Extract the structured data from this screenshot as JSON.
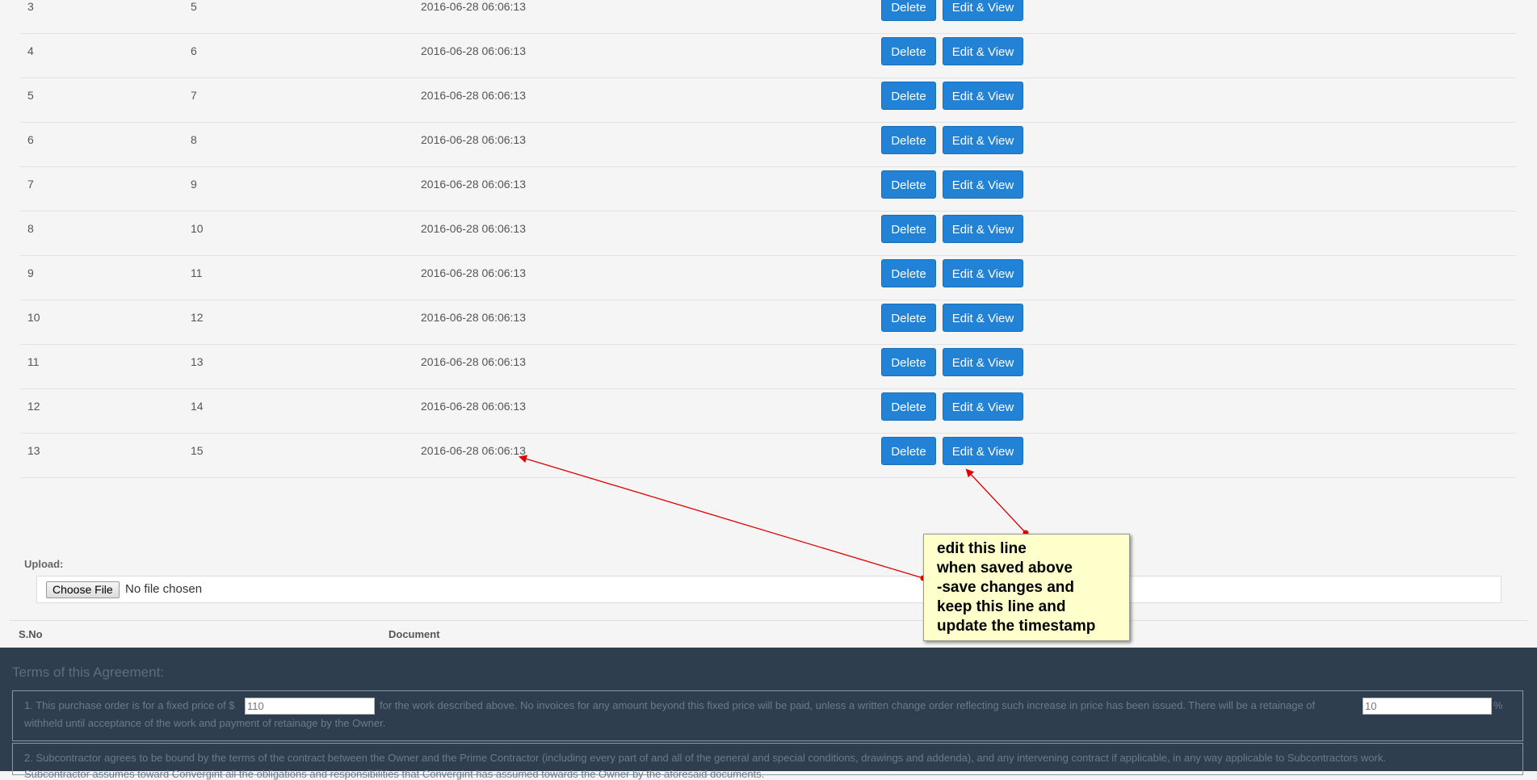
{
  "table": {
    "rows": [
      {
        "sno": "3",
        "id": "5",
        "timestamp": "2016-06-28 06:06:13"
      },
      {
        "sno": "4",
        "id": "6",
        "timestamp": "2016-06-28 06:06:13"
      },
      {
        "sno": "5",
        "id": "7",
        "timestamp": "2016-06-28 06:06:13"
      },
      {
        "sno": "6",
        "id": "8",
        "timestamp": "2016-06-28 06:06:13"
      },
      {
        "sno": "7",
        "id": "9",
        "timestamp": "2016-06-28 06:06:13"
      },
      {
        "sno": "8",
        "id": "10",
        "timestamp": "2016-06-28 06:06:13"
      },
      {
        "sno": "9",
        "id": "11",
        "timestamp": "2016-06-28 06:06:13"
      },
      {
        "sno": "10",
        "id": "12",
        "timestamp": "2016-06-28 06:06:13"
      },
      {
        "sno": "11",
        "id": "13",
        "timestamp": "2016-06-28 06:06:13"
      },
      {
        "sno": "12",
        "id": "14",
        "timestamp": "2016-06-28 06:06:13"
      },
      {
        "sno": "13",
        "id": "15",
        "timestamp": "2016-06-28 06:06:13"
      }
    ],
    "delete_label": "Delete",
    "edit_label": "Edit & View"
  },
  "upload": {
    "label": "Upload:",
    "choose_label": "Choose File",
    "status": "No file chosen"
  },
  "documents": {
    "headers": [
      "S.No",
      "Document"
    ]
  },
  "terms": {
    "title": "Terms of this Agreement:",
    "clause1_a": "1. This purchase order is for a fixed price of $",
    "price_value": "110",
    "clause1_b": "for the work described above. No invoices for any amount beyond this fixed price will be paid, unless a written change order reflecting such increase in price has been issued. There will be a retainage of",
    "retainage_value": "10",
    "clause1_c": "%",
    "clause1_line2": "withheld until acceptance of the work and payment of retainage by the Owner.",
    "clause2_line1": "2. Subcontractor agrees to be bound by the terms of the contract between the Owner and the Prime Contractor (including every part of and all of the general and special conditions, drawings and addenda), and any intervening contract if applicable, in any way applicable to Subcontractors work.",
    "clause2_line2": "Subcontractor assumes toward Convergint all the obligations and responsibilities that Convergint has assumed towards the Owner by the aforesaid documents."
  },
  "annotation": {
    "lines": [
      "edit this line",
      "when saved above",
      "-save changes and",
      "keep this line and",
      "update the timestamp"
    ],
    "arrow_color": "#e00000",
    "note_color": "#ffffcc"
  },
  "colors": {
    "button": "#2283d6",
    "footer": "#2f3e4e"
  }
}
